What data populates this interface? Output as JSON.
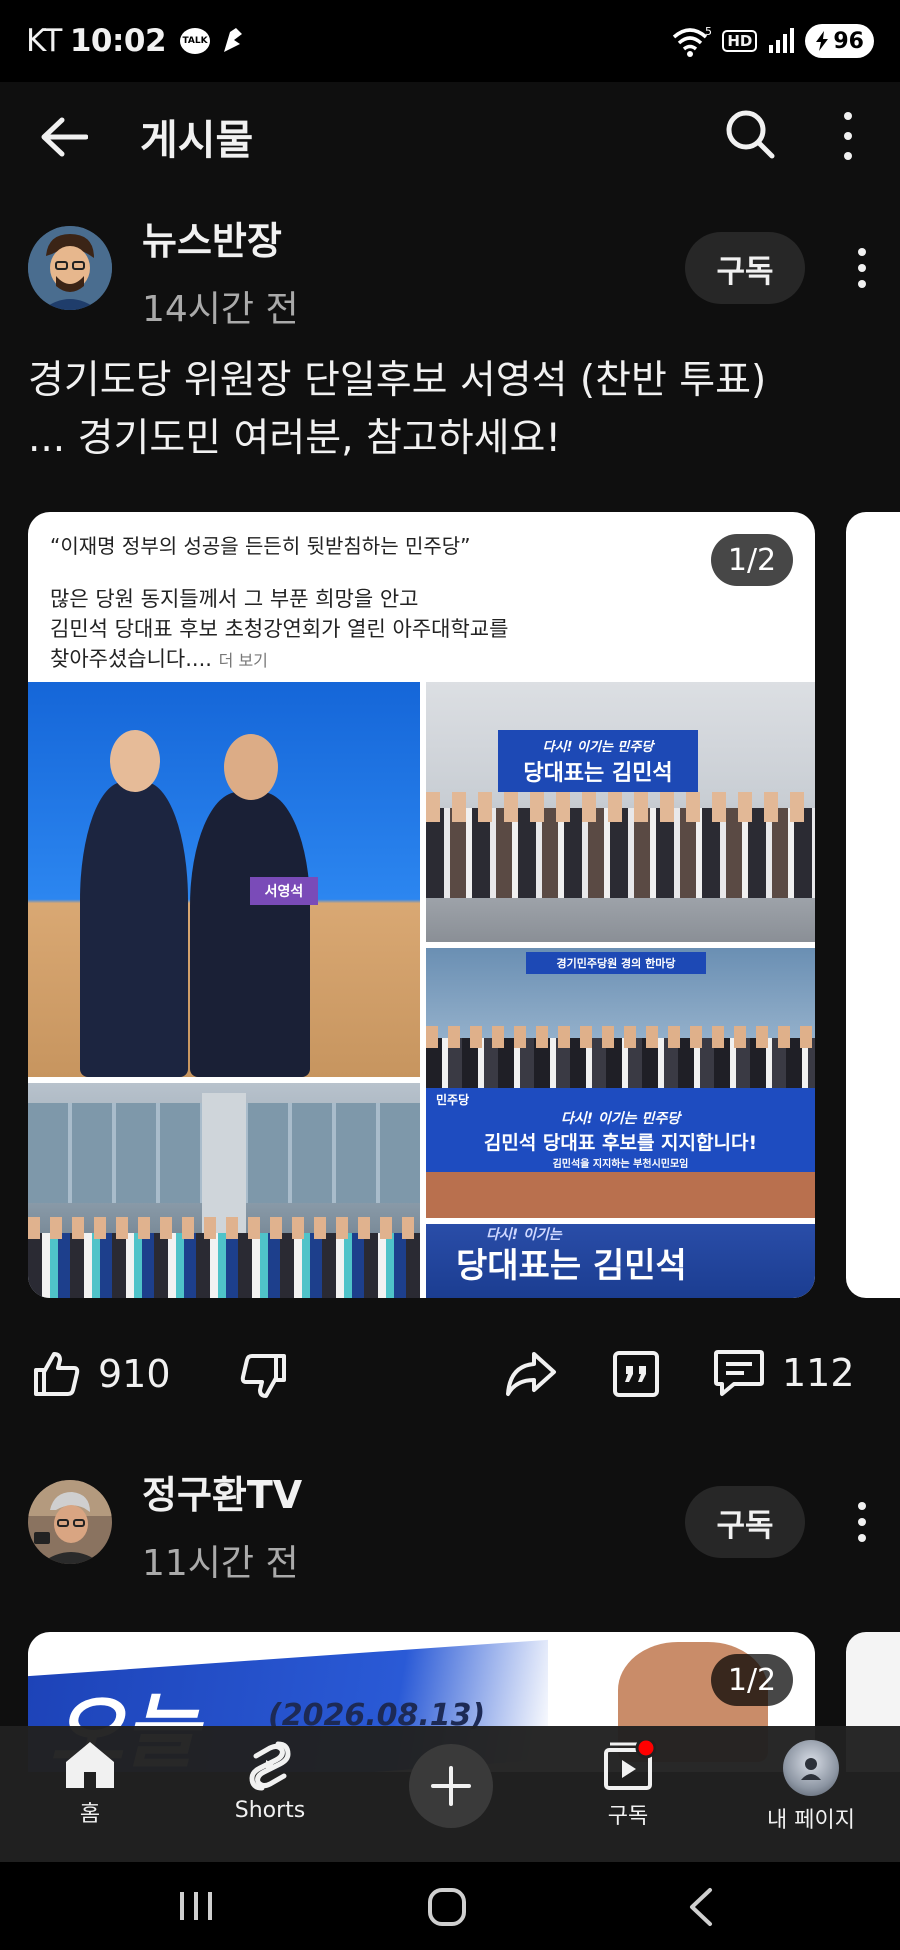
{
  "status_bar": {
    "carrier": "KT",
    "time": "10:02",
    "talk_badge": "TALK",
    "wifi_sup": "5",
    "hd": "HD",
    "battery": "96"
  },
  "header": {
    "title": "게시물"
  },
  "posts": [
    {
      "channel": "뉴스반장",
      "time": "14시간 전",
      "subscribe_label": "구독",
      "text_line1": "경기도당 위원장 단일후보 서영석 (찬반 투표)",
      "text_line2": "... 경기도민 여러분, 참고하세요!",
      "card": {
        "quote": "“이재명 정부의 성공을 든든히 뒷받침하는 민주당”",
        "body_line1": "많은 당원 동지들께서 그 부푼 희망을 안고",
        "body_line2": "김민석 당대표 후보 초청강연회가 열린 아주대학교를",
        "body_line3": "찾아주셨습니다....",
        "more_label": "더 보기",
        "counter": "1/2",
        "badge_text": "서영석",
        "banner_top": "다시! 이기는 민주당",
        "banner_main": "당대표는 김민석",
        "banner3_sub": "경기민주당원 경의 한마당",
        "banner3_small": "민주당",
        "banner3_main": "다시! 이기는 민주당",
        "banner3_line": "김민석 당대표 후보를 지지합니다!",
        "banner3_foot": "김민석을 지지하는 부천시민모임",
        "banner5_top": "다시! 이기는",
        "banner5_main": "당대표는 김민석"
      },
      "likes": "910",
      "comments": "112"
    },
    {
      "channel": "정구환TV",
      "time": "11시간 전",
      "subscribe_label": "구독",
      "card": {
        "counter": "1/2",
        "headline": "오늘",
        "date": "(2026.08.13)"
      }
    }
  ],
  "bottom_nav": {
    "home": "홈",
    "shorts": "Shorts",
    "subscriptions": "구독",
    "my_page": "내 페이지"
  },
  "colors": {
    "background": "#0f0f0f",
    "chip": "#272727",
    "notification_dot": "#ff0000",
    "banner_blue": "#1d49b5"
  }
}
